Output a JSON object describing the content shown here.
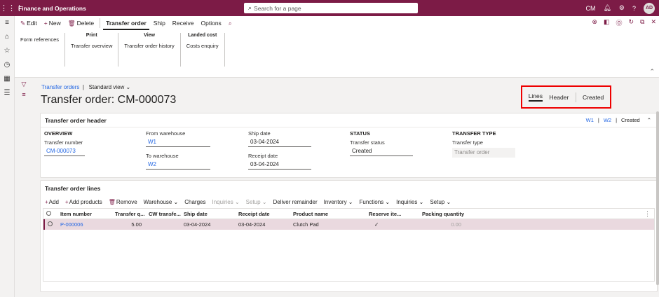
{
  "app": {
    "title": "Finance and Operations",
    "company": "CM",
    "user_initials": "AD"
  },
  "search": {
    "placeholder": "Search for a page"
  },
  "action_pane": {
    "buttons": {
      "edit": "Edit",
      "new": "New",
      "delete": "Delete"
    },
    "tabs": [
      "Transfer order",
      "Ship",
      "Receive",
      "Options"
    ],
    "active_tab": "Transfer order",
    "groups": [
      {
        "title": "",
        "items": [
          "Form references"
        ]
      },
      {
        "title": "Print",
        "items": [
          "Transfer overview"
        ]
      },
      {
        "title": "View",
        "items": [
          "Transfer order history"
        ]
      },
      {
        "title": "Landed cost",
        "items": [
          "Costs enquiry"
        ]
      }
    ]
  },
  "breadcrumb": {
    "link": "Transfer orders",
    "view": "Standard view"
  },
  "page_title": "Transfer order: CM-000073",
  "view_switch": {
    "lines": "Lines",
    "header": "Header",
    "status": "Created"
  },
  "header_fasttab": {
    "title": "Transfer order header",
    "summary": [
      "W1",
      "W2",
      "Created"
    ],
    "overview_title": "OVERVIEW",
    "transfer_number_label": "Transfer number",
    "transfer_number": "CM-000073",
    "from_wh_label": "From warehouse",
    "from_wh": "W1",
    "to_wh_label": "To warehouse",
    "to_wh": "W2",
    "ship_date_label": "Ship date",
    "ship_date": "03-04-2024",
    "receipt_date_label": "Receipt date",
    "receipt_date": "03-04-2024",
    "status_title": "STATUS",
    "transfer_status_label": "Transfer status",
    "transfer_status": "Created",
    "type_title": "TRANSFER TYPE",
    "transfer_type_label": "Transfer type",
    "transfer_type": "Transfer order"
  },
  "lines_fasttab": {
    "title": "Transfer order lines",
    "toolbar": [
      "Add",
      "Add products",
      "Remove",
      "Warehouse",
      "Charges",
      "Inquiries",
      "Setup",
      "Deliver remainder",
      "Inventory",
      "Functions",
      "Inquiries",
      "Setup"
    ],
    "columns": [
      "Item number",
      "Transfer q...",
      "CW transfe...",
      "Ship date",
      "Receipt date",
      "Product name",
      "Reserve ite...",
      "Packing quantity"
    ],
    "rows": [
      {
        "item": "P-000006",
        "qty": "5.00",
        "cw": "",
        "ship": "03-04-2024",
        "receipt": "03-04-2024",
        "product": "Clutch Pad",
        "reserve": "✓",
        "packing": "0.00"
      }
    ]
  }
}
